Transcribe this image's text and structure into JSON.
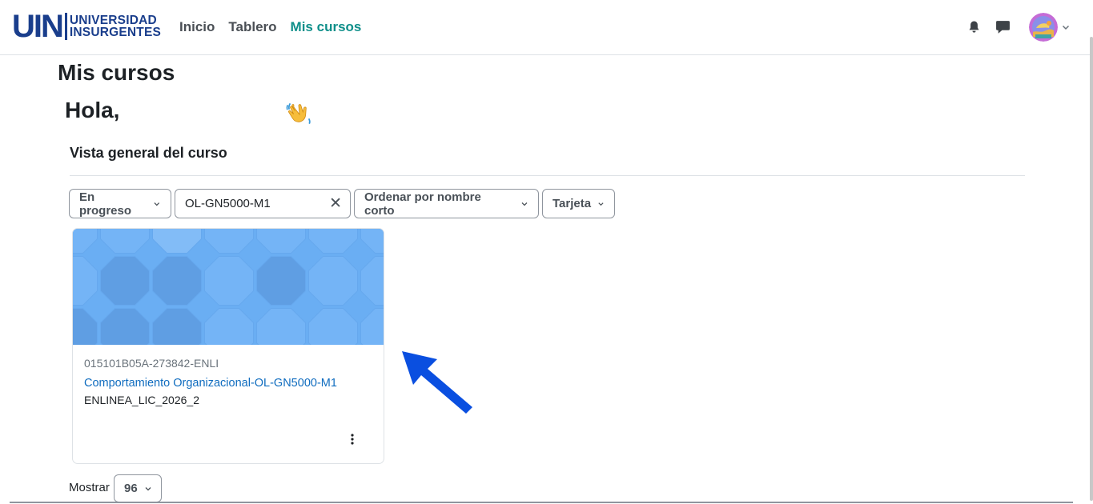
{
  "header": {
    "logo": {
      "short": "UIN",
      "line1": "UNIVERSIDAD",
      "line2": "INSURGENTES"
    },
    "nav": [
      {
        "label": "Inicio"
      },
      {
        "label": "Tablero"
      },
      {
        "label": "Mis cursos",
        "active": true
      }
    ],
    "icons": [
      "bell-icon",
      "chat-icon",
      "avatar",
      "chevron-down-icon"
    ]
  },
  "page": {
    "title": "Mis cursos",
    "greeting": "Hola,",
    "greeting_emoji": "waving-hand-icon"
  },
  "overview": {
    "title": "Vista general del curso",
    "filters": {
      "progress": "En progreso",
      "search_value": "OL-GN5000-M1",
      "sort": "Ordenar por nombre corto",
      "view": "Tarjeta"
    }
  },
  "course": {
    "code": "015101B05A-273842-ENLI",
    "name": "Comportamiento Organizacional-OL-GN5000-M1",
    "category": "ENLINEA_LIC_2026_2"
  },
  "pagination": {
    "show_label": "Mostrar",
    "per_page": "96"
  },
  "colors": {
    "brand": "#1a3e8c",
    "active_nav": "#0f8f8a",
    "link": "#0f6cbf",
    "arrow": "#0a4fe0",
    "card_image": "#6db0f5"
  }
}
